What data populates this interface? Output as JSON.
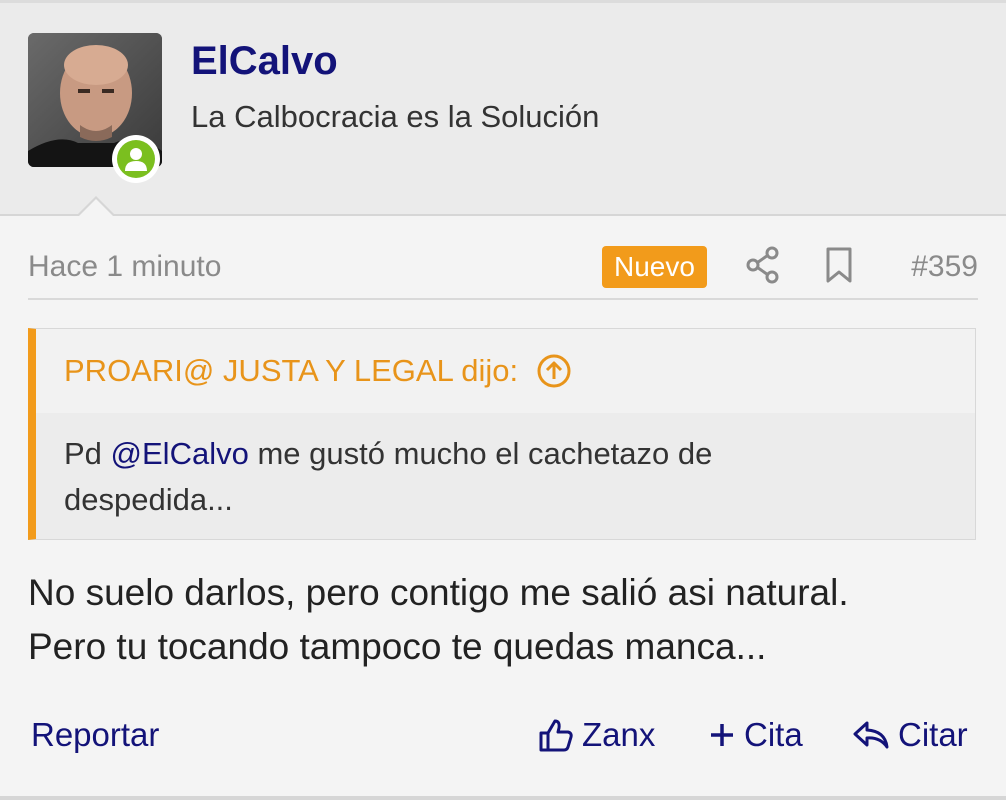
{
  "user": {
    "name": "ElCalvo",
    "title": "La Calbocracia es la Solución",
    "status": "online"
  },
  "post": {
    "time": "Hace 1 minuto",
    "badge": "Nuevo",
    "number": "#359",
    "text_line1": "No suelo darlos, pero contigo me salió asi natural.",
    "text_line2": "Pero tu tocando tampoco te quedas manca..."
  },
  "quote": {
    "author": "PROARI@ JUSTA Y LEGAL dijo:",
    "prefix": "Pd ",
    "mention": "@ElCalvo",
    "rest_line1": " me gustó mucho el cachetazo de",
    "line2": "despedida..."
  },
  "actions": {
    "report": "Reportar",
    "like": "Zanx",
    "multiquote": "Cita",
    "reply": "Citar"
  },
  "colors": {
    "accent": "#f29b1b",
    "link": "#131379",
    "online": "#7bbf1f"
  }
}
